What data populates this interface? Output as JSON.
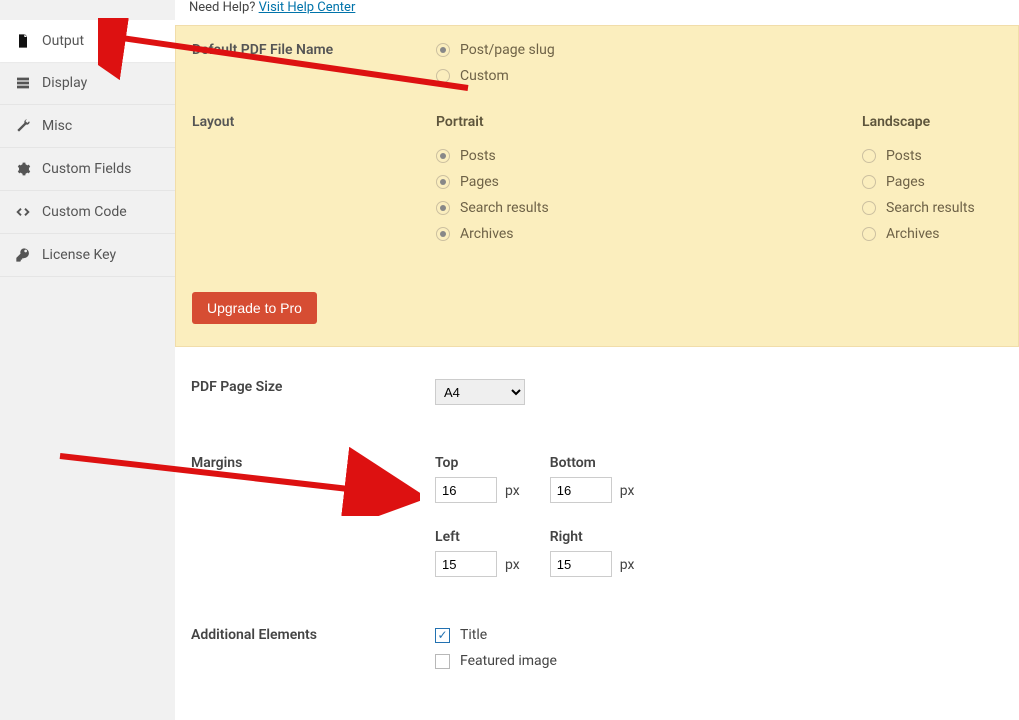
{
  "help": {
    "prefix": "Need Help? ",
    "link_text": "Visit Help Center"
  },
  "sidebar": {
    "items": [
      {
        "label": "Output",
        "active": true,
        "icon": "document-icon"
      },
      {
        "label": "Display",
        "active": false,
        "icon": "grid-icon"
      },
      {
        "label": "Misc",
        "active": false,
        "icon": "wrench-icon"
      },
      {
        "label": "Custom Fields",
        "active": false,
        "icon": "gear-icon"
      },
      {
        "label": "Custom Code",
        "active": false,
        "icon": "code-icon"
      },
      {
        "label": "License Key",
        "active": false,
        "icon": "key-icon"
      }
    ]
  },
  "filename": {
    "label": "Default PDF File Name",
    "options": [
      {
        "label": "Post/page slug",
        "checked": true
      },
      {
        "label": "Custom",
        "checked": false
      }
    ]
  },
  "layout": {
    "label": "Layout",
    "portrait": {
      "head": "Portrait",
      "items": [
        {
          "label": "Posts",
          "checked": true
        },
        {
          "label": "Pages",
          "checked": true
        },
        {
          "label": "Search results",
          "checked": true
        },
        {
          "label": "Archives",
          "checked": true
        }
      ]
    },
    "landscape": {
      "head": "Landscape",
      "items": [
        {
          "label": "Posts",
          "checked": false
        },
        {
          "label": "Pages",
          "checked": false
        },
        {
          "label": "Search results",
          "checked": false
        },
        {
          "label": "Archives",
          "checked": false
        }
      ]
    },
    "upgrade_label": "Upgrade to Pro"
  },
  "page_size": {
    "label": "PDF Page Size",
    "value": "A4"
  },
  "margins": {
    "label": "Margins",
    "top": {
      "name": "Top",
      "value": "16",
      "unit": "px"
    },
    "bottom": {
      "name": "Bottom",
      "value": "16",
      "unit": "px"
    },
    "left": {
      "name": "Left",
      "value": "15",
      "unit": "px"
    },
    "right": {
      "name": "Right",
      "value": "15",
      "unit": "px"
    }
  },
  "additional": {
    "label": "Additional Elements",
    "items": [
      {
        "label": "Title",
        "checked": true
      },
      {
        "label": "Featured image",
        "checked": false
      }
    ]
  }
}
